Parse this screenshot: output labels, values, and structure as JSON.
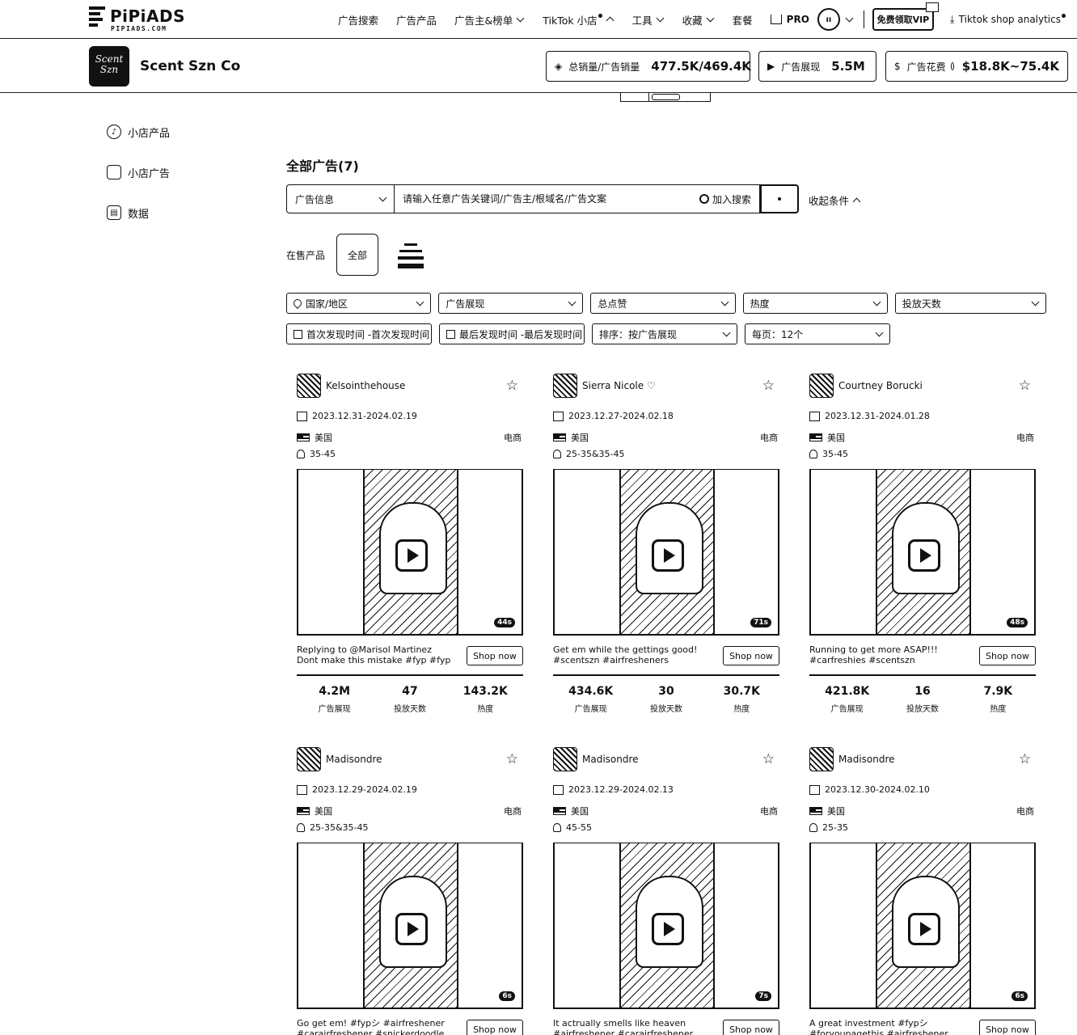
{
  "topnav": {
    "logo": "PiPiADS",
    "logo_sub": "PIPIADS.COM",
    "items": [
      {
        "label": "广告搜索"
      },
      {
        "label": "广告产品"
      },
      {
        "label": "广告主&榜单"
      },
      {
        "label": "TikTok 小店"
      },
      {
        "label": "工具"
      },
      {
        "label": "收藏"
      },
      {
        "label": "套餐"
      }
    ],
    "pro_label": "PRO",
    "vip_label": "免费领取VIP",
    "analytics_label": "Tiktok shop analytics"
  },
  "store": {
    "logo_line1": "Scent",
    "logo_line2": "Szn",
    "name": "Scent Szn Co",
    "stats": [
      {
        "icon": "tag-icon",
        "label": "总销量/广告销量",
        "value": "477.5K/469.4K"
      },
      {
        "icon": "play-icon",
        "label": "广告展现",
        "value": "5.5M"
      },
      {
        "icon": "dollar-icon",
        "label": "广告花费",
        "value": "$18.8K~75.4K"
      }
    ]
  },
  "sidebar": {
    "items": [
      {
        "label": "小店产品"
      },
      {
        "label": "小店广告"
      },
      {
        "label": "数据"
      }
    ]
  },
  "main": {
    "title": "全部广告(7)",
    "search": {
      "type": "广告信息",
      "placeholder": "请输入任意广告关键词/广告主/根域名/广告文案",
      "add_label": "加入搜索"
    },
    "collapse_label": "收起条件",
    "products_label": "在售产品",
    "products_all": "全部",
    "filters_row1": [
      "国家/地区",
      "广告展现",
      "总点赞",
      "热度",
      "投放天数"
    ],
    "filters_row2": [
      "首次发现时间 -首次发现时间",
      "最后发现时间 -最后发现时间",
      "排序：按广告展现",
      "每页：12个"
    ]
  },
  "cards": [
    {
      "name": "Kelsointhehouse",
      "date": "2023.12.31-2024.02.19",
      "country": "美国",
      "category": "电商",
      "age": "35-45",
      "duration": "44s",
      "caption": "Replying to @Marisol Martinez Dont make this mistake #fyp #fypシ...",
      "shop": "Shop now",
      "impressions": "4.2M",
      "days": "47",
      "heat": "143.2K"
    },
    {
      "name": "Sierra Nicole ♡",
      "date": "2023.12.27-2024.02.18",
      "country": "美国",
      "category": "电商",
      "age": "25-35&35-45",
      "duration": "71s",
      "caption": "Get em while the gettings good! #scentszn #airfresheners",
      "shop": "Shop now",
      "impressions": "434.6K",
      "days": "30",
      "heat": "30.7K"
    },
    {
      "name": "Courtney Borucki",
      "date": "2023.12.31-2024.01.28",
      "country": "美国",
      "category": "电商",
      "age": "35-45",
      "duration": "48s",
      "caption": "Running to get more ASAP!!! #carfreshies #scentszn #carfreshener...",
      "shop": "Shop now",
      "impressions": "421.8K",
      "days": "16",
      "heat": "7.9K"
    },
    {
      "name": "Madisondre",
      "date": "2023.12.29-2024.02.19",
      "country": "美国",
      "category": "电商",
      "age": "25-35&35-45",
      "duration": "6s",
      "caption": "Go get em! #fypシ #airfreshener #carairfreshener #snickerdoodle",
      "shop": "Shop now",
      "impressions": "",
      "days": "",
      "heat": ""
    },
    {
      "name": "Madisondre",
      "date": "2023.12.29-2024.02.13",
      "country": "美国",
      "category": "电商",
      "age": "45-55",
      "duration": "7s",
      "caption": "It actrually smells like heaven #airfreshener #carairfreshener",
      "shop": "Shop now",
      "impressions": "",
      "days": "",
      "heat": ""
    },
    {
      "name": "Madisondre",
      "date": "2023.12.30-2024.02.10",
      "country": "美国",
      "category": "电商",
      "age": "25-35",
      "duration": "6s",
      "caption": "A great investment #fypシ #foryoupagethis #airfreshener",
      "shop": "Shop now",
      "impressions": "",
      "days": "",
      "heat": ""
    }
  ],
  "stat_labels": {
    "impressions": "广告展现",
    "days": "投放天数",
    "heat": "热度"
  }
}
